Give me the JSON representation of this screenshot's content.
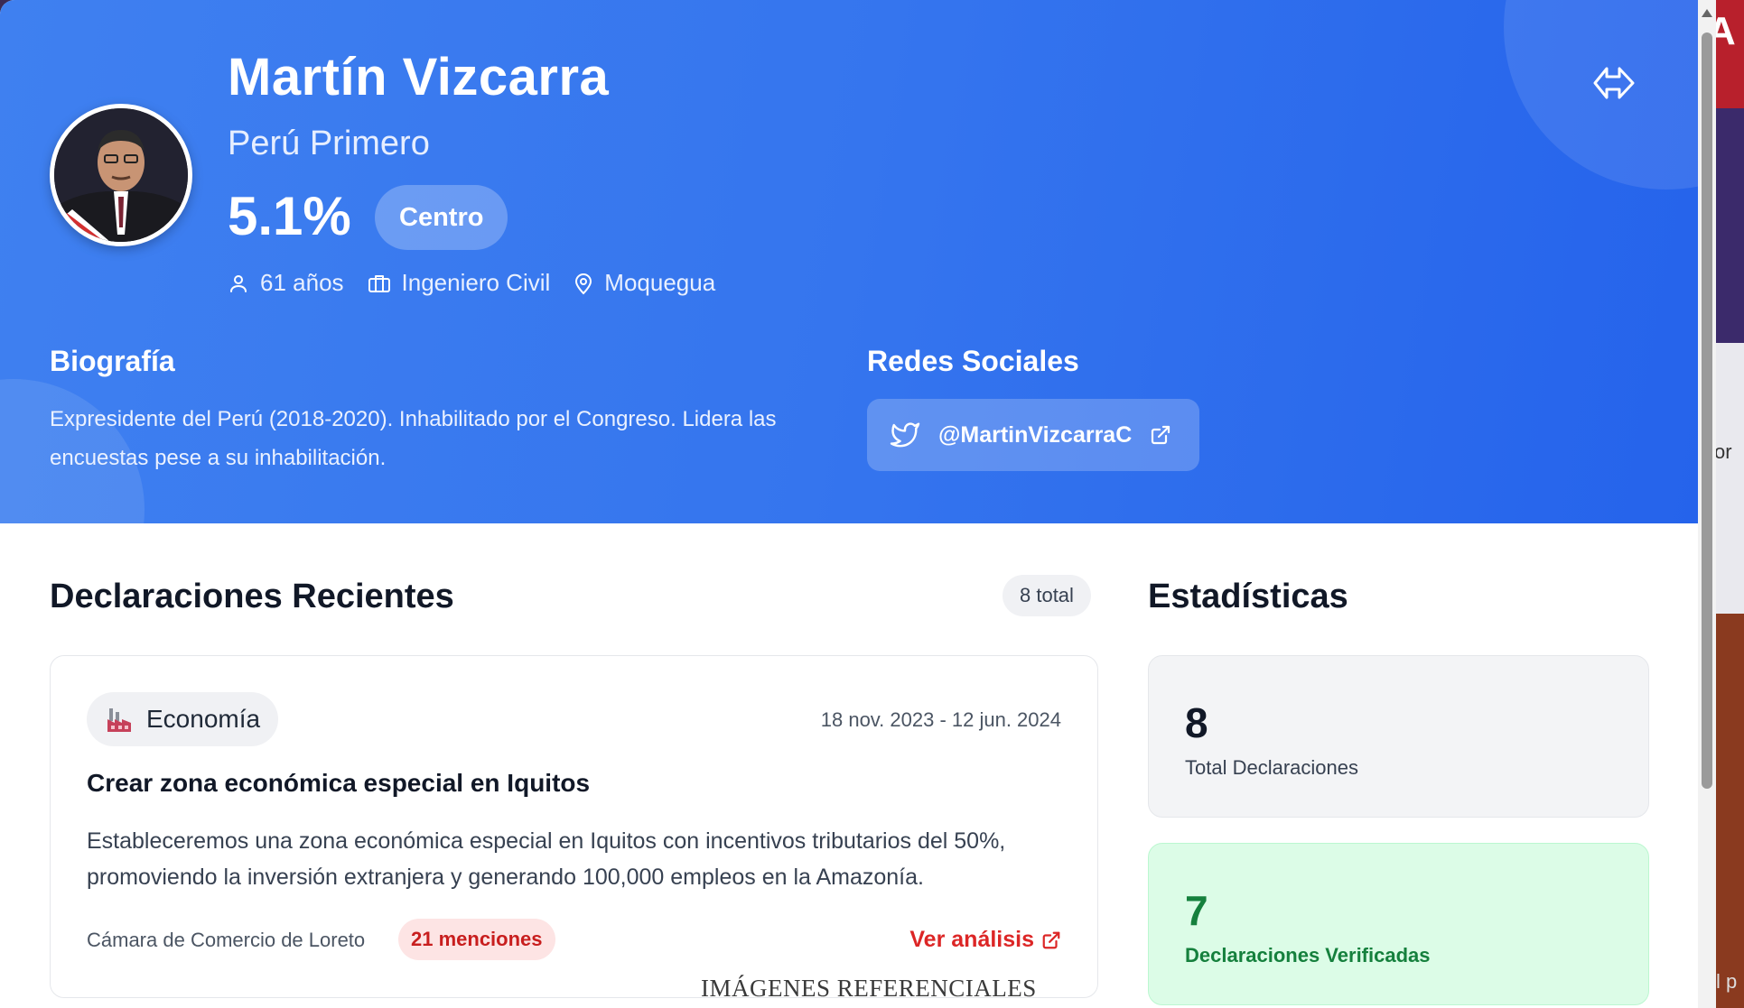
{
  "candidate": {
    "name": "Martín Vizcarra",
    "party": "Perú Primero",
    "percent": "5.1%",
    "ideology": "Centro",
    "age": "61 años",
    "profession": "Ingeniero Civil",
    "region": "Moquegua"
  },
  "biography": {
    "title": "Biografía",
    "text": "Expresidente del Perú (2018-2020). Inhabilitado por el Congreso. Lidera las encuestas pese a su inhabilitación."
  },
  "social": {
    "title": "Redes Sociales",
    "twitter_handle": "@MartinVizcarraC"
  },
  "declarations": {
    "title": "Declaraciones Recientes",
    "total_label": "8 total",
    "items": [
      {
        "category": "Economía",
        "date_range": "18 nov. 2023 - 12 jun. 2024",
        "title": "Crear zona económica especial en Iquitos",
        "description": "Estableceremos una zona económica especial en Iquitos con incentivos tributarios del 50%, promoviendo la inversión extranjera y generando 100,000 empleos en la Amazonía.",
        "source": "Cámara de Comercio de Loreto",
        "mentions": "21 menciones",
        "link_label": "Ver análisis"
      }
    ]
  },
  "stats": {
    "title": "Estadísticas",
    "items": [
      {
        "value": "8",
        "label": "Total Declaraciones"
      },
      {
        "value": "7",
        "label": "Declaraciones Verificadas"
      }
    ]
  },
  "watermark": "IMÁGENES REFERENCIALES",
  "colors": {
    "hero": "#3575ee",
    "accent_red": "#dc2626",
    "verified_green": "#15803d"
  }
}
